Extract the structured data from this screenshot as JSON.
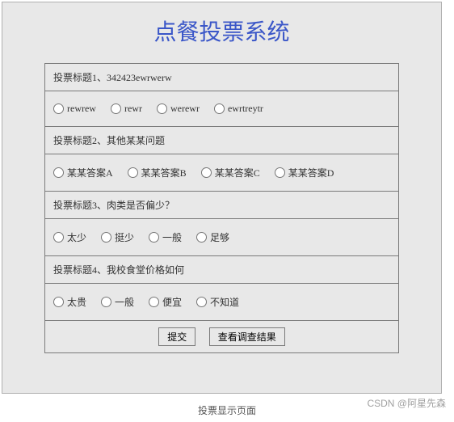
{
  "title": "点餐投票系统",
  "questions": [
    {
      "label": "投票标题1、342423ewrwerw",
      "options": [
        "rewrew",
        "rewr",
        "werewr",
        "ewrtreytr"
      ]
    },
    {
      "label": "投票标题2、其他某某问题",
      "options": [
        "某某答案A",
        "某某答案B",
        "某某答案C",
        "某某答案D"
      ]
    },
    {
      "label": "投票标题3、肉类是否偏少？",
      "options": [
        "太少",
        "挺少",
        "一般",
        "足够"
      ]
    },
    {
      "label": "投票标题4、我校食堂价格如何",
      "options": [
        "太贵",
        "一般",
        "便宜",
        "不知道"
      ]
    }
  ],
  "buttons": {
    "submit": "提交",
    "view_results": "查看调查结果"
  },
  "caption": "投票显示页面",
  "watermark": "CSDN @阿星先森"
}
